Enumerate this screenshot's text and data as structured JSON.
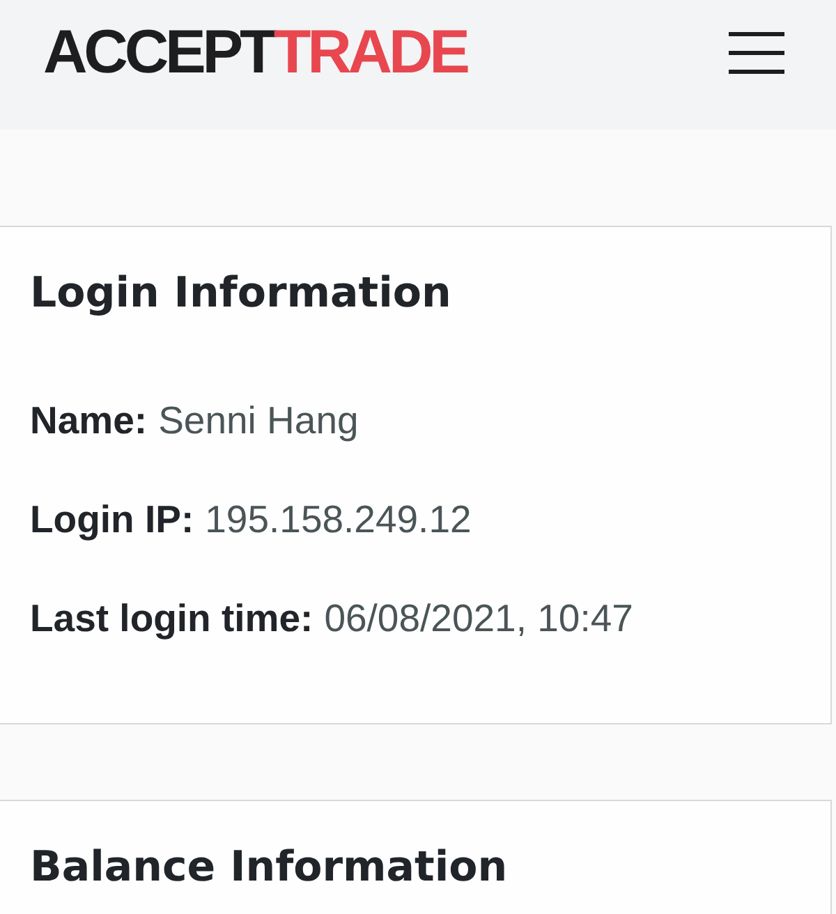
{
  "header": {
    "logo": [
      {
        "text": "ACCEPT",
        "color": "#1e1e20"
      },
      {
        "text": "TRADE",
        "color": "#e8474f"
      }
    ]
  },
  "sections": [
    {
      "title": "Login Information",
      "fields": [
        {
          "label": "Name:",
          "value": "Senni Hang"
        },
        {
          "label": "Login IP:",
          "value": "195.158.249.12"
        },
        {
          "label": "Last login time:",
          "value": "06/08/2021, 10:47"
        }
      ]
    },
    {
      "title": "Balance Information"
    }
  ]
}
